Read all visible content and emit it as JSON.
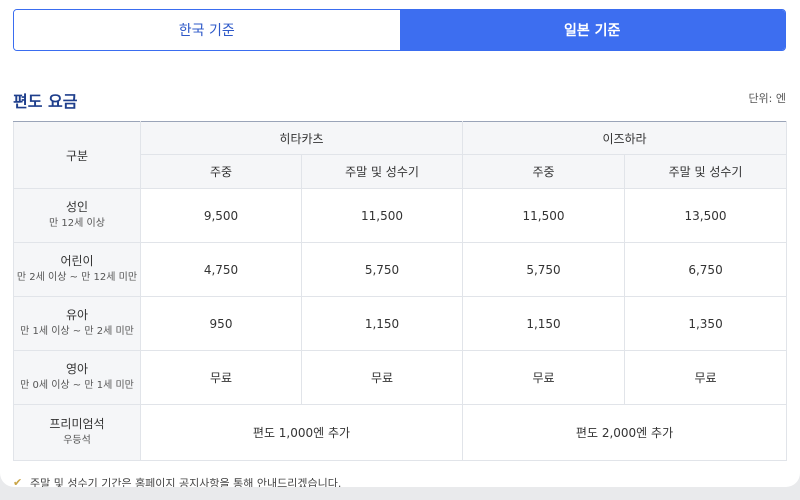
{
  "tabs": [
    {
      "label": "한국 기준",
      "active": false
    },
    {
      "label": "일본 기준",
      "active": true
    }
  ],
  "section": {
    "title": "편도 요금",
    "unit": "단위: 엔"
  },
  "table": {
    "corner": "구분",
    "ports": [
      "히타카츠",
      "이즈하라"
    ],
    "periods": [
      "주중",
      "주말 및 성수기",
      "주중",
      "주말 및 성수기"
    ],
    "rows": [
      {
        "label": "성인",
        "sub": "만 12세 이상",
        "values": [
          "9,500",
          "11,500",
          "11,500",
          "13,500"
        ]
      },
      {
        "label": "어린이",
        "sub": "만 2세 이상 ~ 만 12세 미만",
        "values": [
          "4,750",
          "5,750",
          "5,750",
          "6,750"
        ]
      },
      {
        "label": "유아",
        "sub": "만 1세 이상 ~ 만 2세 미만",
        "values": [
          "950",
          "1,150",
          "1,150",
          "1,350"
        ]
      },
      {
        "label": "영아",
        "sub": "만 0세 이상 ~ 만 1세 미만",
        "values": [
          "무료",
          "무료",
          "무료",
          "무료"
        ]
      }
    ],
    "premium": {
      "label": "프리미엄석",
      "sub": "우등석",
      "values": [
        "편도 1,000엔 추가",
        "편도 2,000엔 추가"
      ]
    }
  },
  "notice": "주말 및 성수기 기간은 홈페이지 공지사항을 통해 안내드리겠습니다.",
  "colors": {
    "accent": "#3d6ef0",
    "title": "#1f3f8c"
  }
}
